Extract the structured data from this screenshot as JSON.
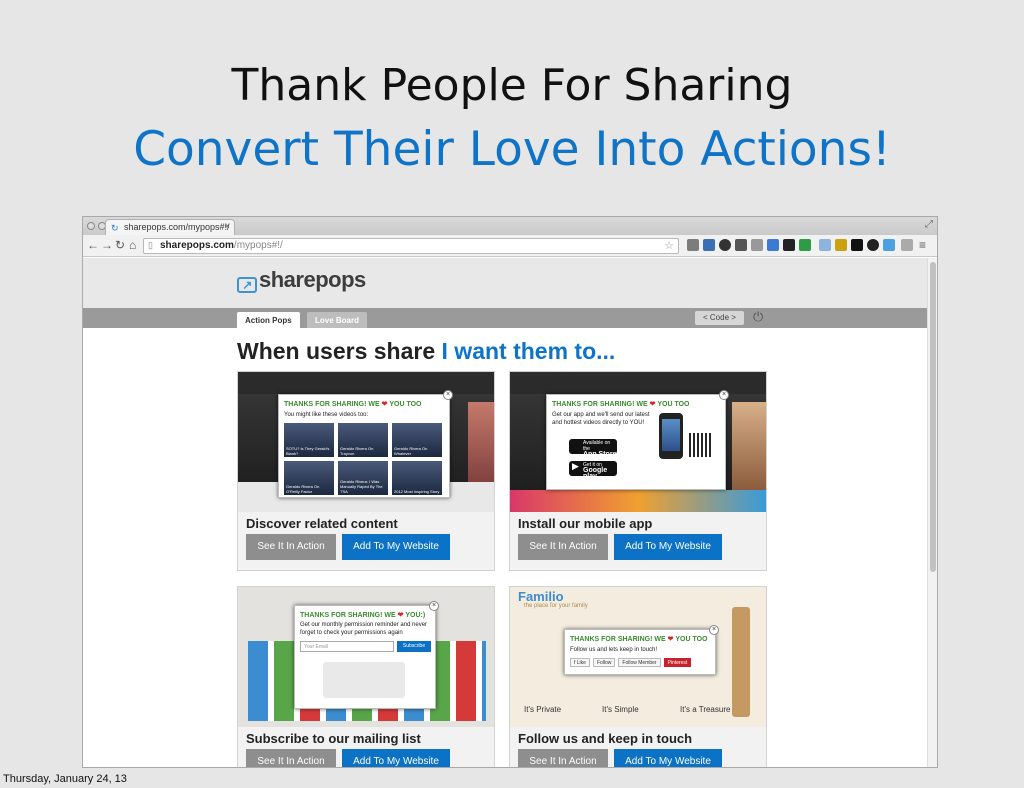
{
  "slide": {
    "title": "Thank People For Sharing",
    "subtitle": "Convert Their Love Into Actions!",
    "footer_date": "Thursday, January 24, 13"
  },
  "browser": {
    "tab_title": "sharepops.com/mypops#!/",
    "url_domain": "sharepops.com",
    "url_path": "/mypops#!/"
  },
  "site": {
    "logo_text": "sharepops",
    "tabs": [
      {
        "label": "Action Pops",
        "active": true
      },
      {
        "label": "Love Board",
        "active": false
      }
    ],
    "code_button": "< Code >",
    "headline_prefix": "When users share",
    "headline_highlight": "I want them to..."
  },
  "cards": [
    {
      "title": "Discover related content",
      "see_label": "See It In Action",
      "add_label": "Add To My Website",
      "popup": {
        "title_prefix": "THANKS FOR SHARING! WE",
        "title_suffix": "YOU TOO",
        "text": "You might like these videos too:",
        "videos": [
          "SOTU? Is They Gerald’s Blank?",
          "Geraldo Rivera On Trayvon",
          "Geraldo Rivera On Whatever",
          "Geraldo Rivera On O’Reilly Factor",
          "Geraldo Rivera: I Was Manually Raped By The TSA",
          "2012 Most Inspiring Story"
        ]
      }
    },
    {
      "title": "Install our mobile app",
      "see_label": "See It In Action",
      "add_label": "Add To My Website",
      "popup": {
        "title_prefix": "THANKS FOR SHARING! WE",
        "title_suffix": "YOU TOO",
        "text": "Get our app and we'll send our latest and hottest videos directly to YOU!",
        "appstore_small": "Available on the",
        "appstore_big": "App Store",
        "googleplay_small": "Get it on",
        "googleplay_big": "Google play"
      }
    },
    {
      "title": "Subscribe to our mailing list",
      "see_label": "See It In Action",
      "add_label": "Add To My Website",
      "popup": {
        "title_prefix": "THANKS FOR SHARING! WE",
        "title_suffix": "YOU:)",
        "text": "Get our monthly permission reminder and never forget to check your permissions again",
        "email_placeholder": "Your Email",
        "subscribe_label": "Subscribe"
      }
    },
    {
      "title": "Follow us and keep in touch",
      "see_label": "See It In Action",
      "add_label": "Add To My Website",
      "popup": {
        "title_prefix": "THANKS FOR SHARING! WE",
        "title_suffix": "YOU TOO",
        "text": "Follow us and lets keep in touch!",
        "social": [
          "f Like",
          "Follow",
          "Follow Member",
          "Pinterest"
        ]
      },
      "bg_brand": "Familio",
      "bg_tag": "the place for your family",
      "bg_cols": [
        "It's Private",
        "It's Simple",
        "It's a Treasure"
      ]
    }
  ],
  "colors": {
    "accent": "#0f74c7",
    "popup_green": "#3a8b2e",
    "add_button": "#0b72c6",
    "see_button": "#8e8e8e"
  }
}
